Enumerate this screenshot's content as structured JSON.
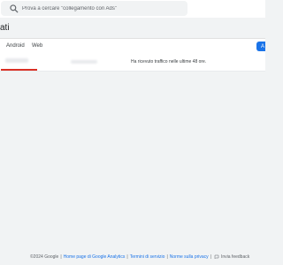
{
  "search": {
    "placeholder": "Prova a cercare \"collegamento con Ads\""
  },
  "page": {
    "title": "ati"
  },
  "tabs": [
    {
      "label": "Android"
    },
    {
      "label": "Web"
    }
  ],
  "action_button": {
    "label": "A"
  },
  "rows": [
    {
      "status": "Ha ricevuto traffico nelle ultime 48 ore."
    }
  ],
  "footer": {
    "copyright": "©2024 Google",
    "links": [
      "Home page di Google Analytics",
      "Termini di servizio",
      "Norme sulla privacy"
    ],
    "feedback": "Invia feedback"
  },
  "colors": {
    "accent": "#1a73e8",
    "underline": "#d93025",
    "background": "#f1f3f4"
  }
}
